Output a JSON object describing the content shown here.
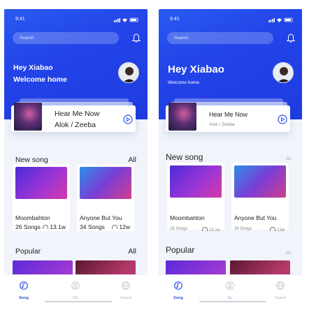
{
  "screens": [
    {
      "status": {
        "time": "9:41"
      },
      "search": {
        "placeholder": "Search"
      },
      "greeting": {
        "line1": "Hey Xiabao",
        "line2": "Welcome home"
      },
      "now_playing": {
        "title": "Hear Me Now",
        "artist": "Alok / Zeeba"
      },
      "sections": {
        "new_song": "New song",
        "popular": "Popular",
        "all": "All"
      },
      "songs": [
        {
          "title": "Moombahton",
          "count": "26 Songs",
          "plays": "13.1w"
        },
        {
          "title": "Anyone But You",
          "count": "34 Songs",
          "plays": "12w"
        }
      ],
      "nav": [
        {
          "label": "Song",
          "icon": "music-note-icon"
        },
        {
          "label": "My",
          "icon": "person-icon"
        },
        {
          "label": "Expert",
          "icon": "globe-icon"
        }
      ]
    },
    {
      "status": {
        "time": "9:41"
      },
      "search": {
        "placeholder": "Search"
      },
      "greeting": {
        "line1": "Hey Xiabao",
        "line2": "Welcome home"
      },
      "now_playing": {
        "title": "Hear Me Now",
        "artist": "Alok / Zeeba"
      },
      "sections": {
        "new_song": "New song",
        "popular": "Popular",
        "all": "All"
      },
      "songs": [
        {
          "title": "Moombahton",
          "count": "26 Songs",
          "plays": "13.1w"
        },
        {
          "title": "Anyone But You",
          "count": "34 Songs",
          "plays": "12w"
        }
      ],
      "nav": [
        {
          "label": "Song",
          "icon": "music-note-icon"
        },
        {
          "label": "My",
          "icon": "person-icon"
        },
        {
          "label": "Expert",
          "icon": "globe-icon"
        }
      ]
    }
  ],
  "colors": {
    "primary": "#2d4fe7",
    "background": "#f1f4fa"
  }
}
